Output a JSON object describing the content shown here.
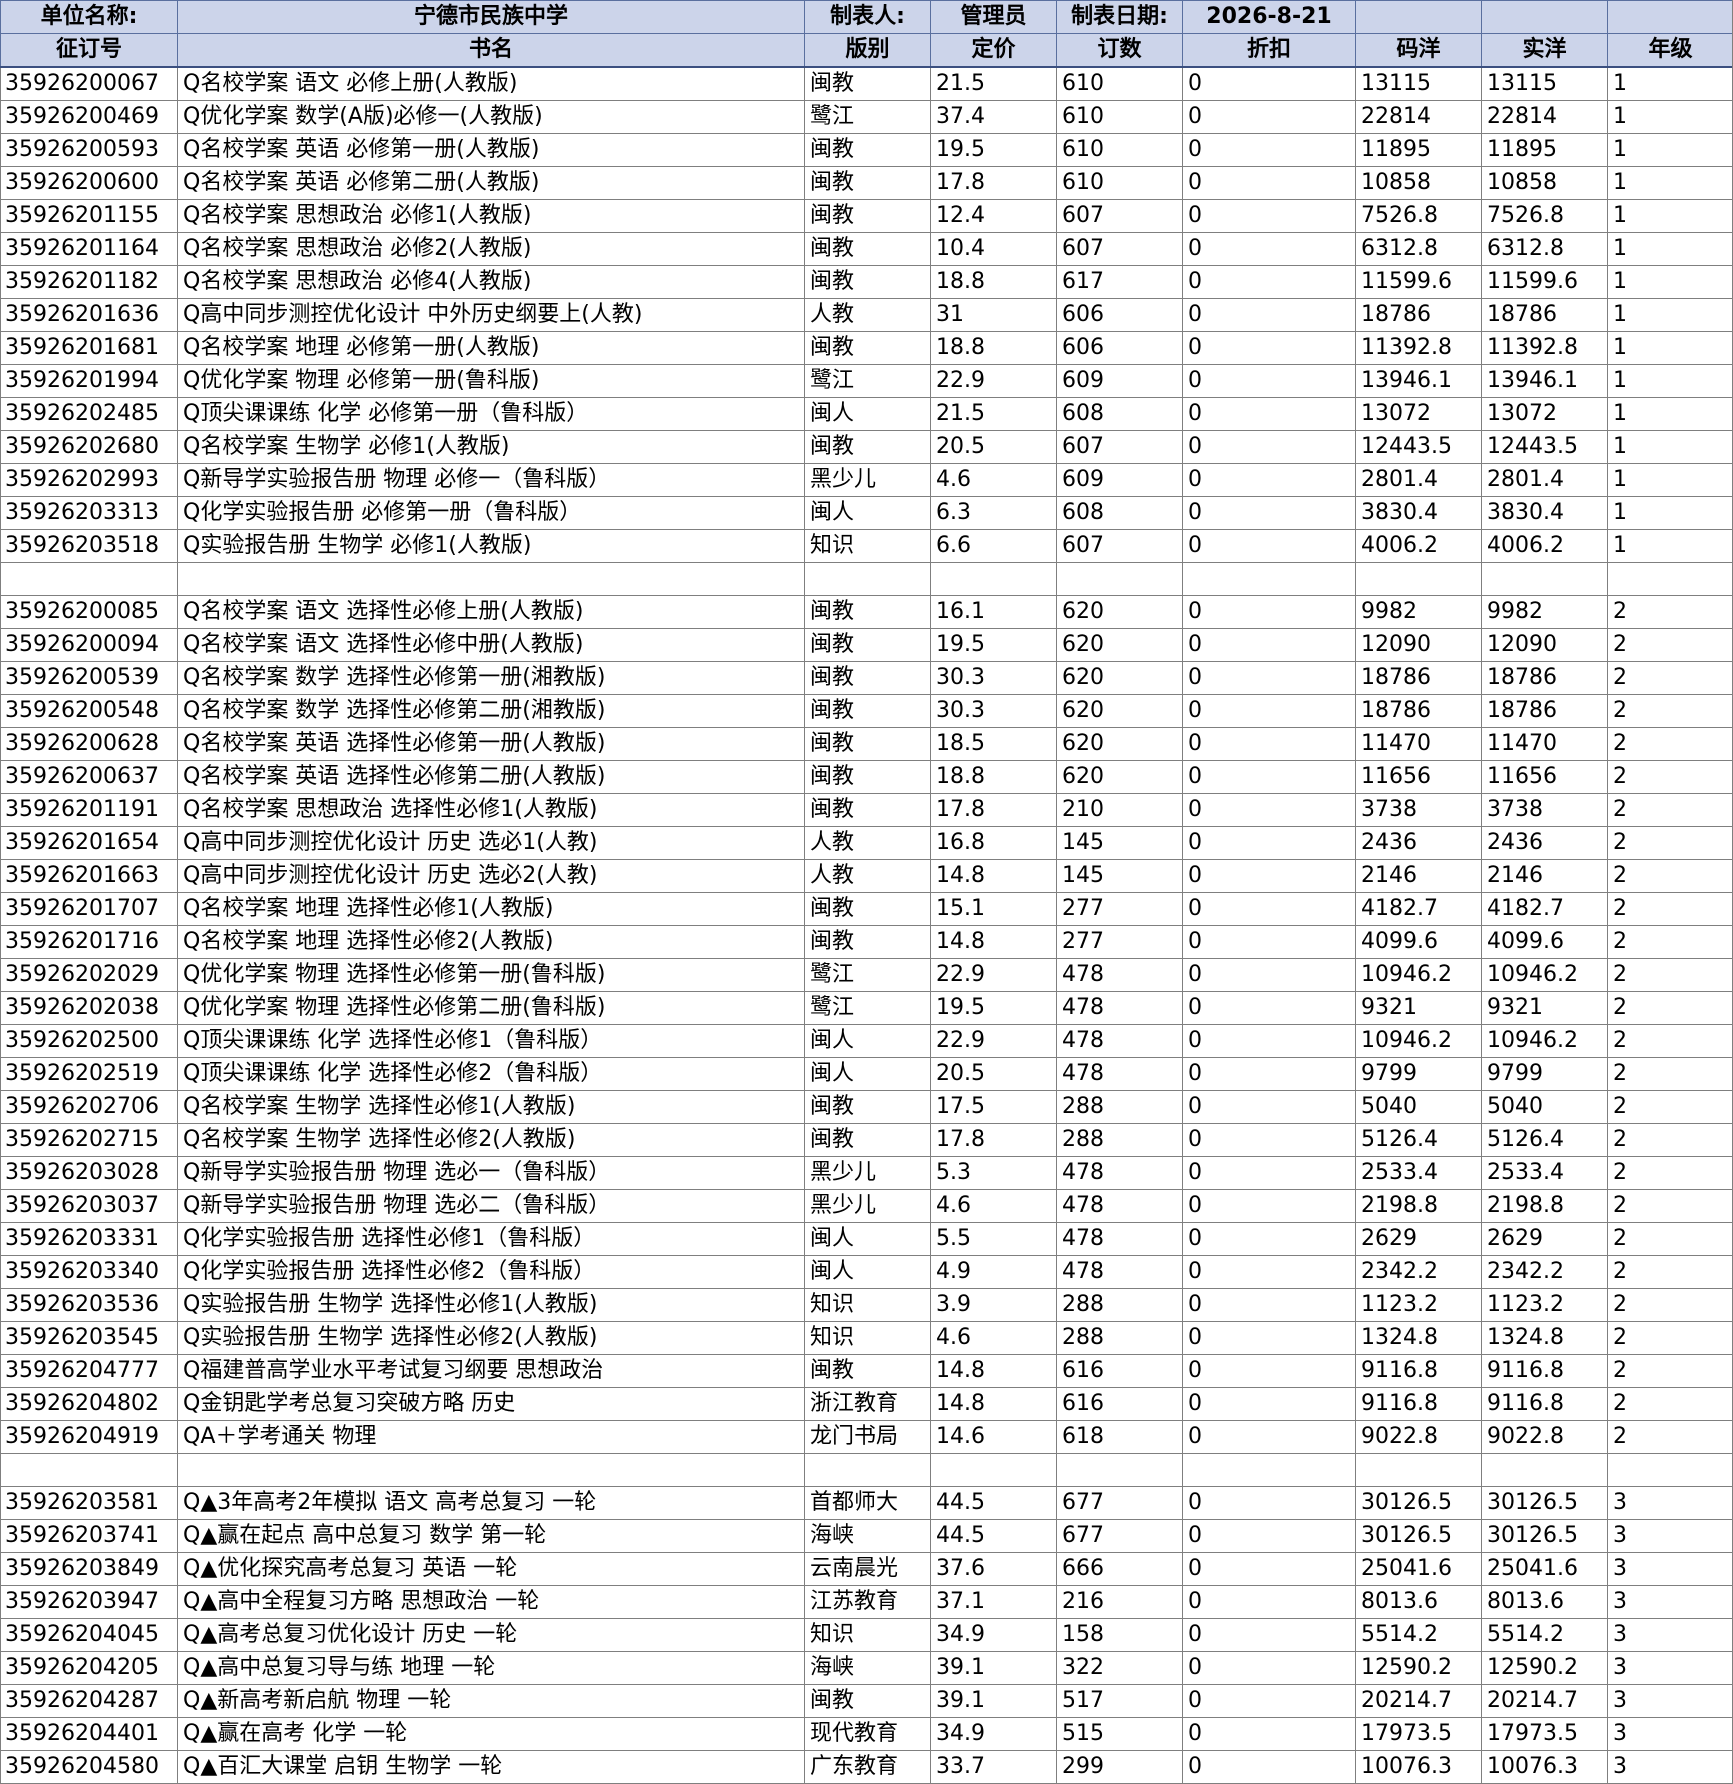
{
  "header": {
    "row0": [
      "单位名称:",
      "宁德市民族中学",
      "制表人:",
      "管理员",
      "制表日期:",
      "2026-8-21",
      "",
      "",
      ""
    ],
    "row1": [
      "征订号",
      "书名",
      "版别",
      "定价",
      "订数",
      "折扣",
      "码洋",
      "实洋",
      "年级"
    ]
  },
  "rows": [
    [
      "35926200067",
      "Q名校学案 语文 必修上册(人教版)",
      "闽教",
      "21.5",
      "610",
      "0",
      "13115",
      "13115",
      "1"
    ],
    [
      "35926200469",
      "Q优化学案 数学(A版)必修一(人教版)",
      "鹭江",
      "37.4",
      "610",
      "0",
      "22814",
      "22814",
      "1"
    ],
    [
      "35926200593",
      "Q名校学案 英语 必修第一册(人教版)",
      "闽教",
      "19.5",
      "610",
      "0",
      "11895",
      "11895",
      "1"
    ],
    [
      "35926200600",
      "Q名校学案 英语 必修第二册(人教版)",
      "闽教",
      "17.8",
      "610",
      "0",
      "10858",
      "10858",
      "1"
    ],
    [
      "35926201155",
      "Q名校学案 思想政治 必修1(人教版)",
      "闽教",
      "12.4",
      "607",
      "0",
      "7526.8",
      "7526.8",
      "1"
    ],
    [
      "35926201164",
      "Q名校学案 思想政治 必修2(人教版)",
      "闽教",
      "10.4",
      "607",
      "0",
      "6312.8",
      "6312.8",
      "1"
    ],
    [
      "35926201182",
      "Q名校学案 思想政治 必修4(人教版)",
      "闽教",
      "18.8",
      "617",
      "0",
      "11599.6",
      "11599.6",
      "1"
    ],
    [
      "35926201636",
      "Q高中同步测控优化设计 中外历史纲要上(人教)",
      "人教",
      "31",
      "606",
      "0",
      "18786",
      "18786",
      "1"
    ],
    [
      "35926201681",
      "Q名校学案 地理 必修第一册(人教版)",
      "闽教",
      "18.8",
      "606",
      "0",
      "11392.8",
      "11392.8",
      "1"
    ],
    [
      "35926201994",
      "Q优化学案 物理 必修第一册(鲁科版)",
      "鹭江",
      "22.9",
      "609",
      "0",
      "13946.1",
      "13946.1",
      "1"
    ],
    [
      "35926202485",
      "Q顶尖课课练 化学 必修第一册（鲁科版）",
      "闽人",
      "21.5",
      "608",
      "0",
      "13072",
      "13072",
      "1"
    ],
    [
      "35926202680",
      "Q名校学案 生物学 必修1(人教版)",
      "闽教",
      "20.5",
      "607",
      "0",
      "12443.5",
      "12443.5",
      "1"
    ],
    [
      "35926202993",
      "Q新导学实验报告册 物理 必修一（鲁科版）",
      "黑少儿",
      "4.6",
      "609",
      "0",
      "2801.4",
      "2801.4",
      "1"
    ],
    [
      "35926203313",
      "Q化学实验报告册 必修第一册（鲁科版）",
      "闽人",
      "6.3",
      "608",
      "0",
      "3830.4",
      "3830.4",
      "1"
    ],
    [
      "35926203518",
      "Q实验报告册 生物学 必修1(人教版)",
      "知识",
      "6.6",
      "607",
      "0",
      "4006.2",
      "4006.2",
      "1"
    ],
    [
      "",
      "",
      "",
      "",
      "",
      "",
      "",
      "",
      ""
    ],
    [
      "35926200085",
      "Q名校学案 语文 选择性必修上册(人教版)",
      "闽教",
      "16.1",
      "620",
      "0",
      "9982",
      "9982",
      "2"
    ],
    [
      "35926200094",
      "Q名校学案 语文 选择性必修中册(人教版)",
      "闽教",
      "19.5",
      "620",
      "0",
      "12090",
      "12090",
      "2"
    ],
    [
      "35926200539",
      "Q名校学案 数学 选择性必修第一册(湘教版)",
      "闽教",
      "30.3",
      "620",
      "0",
      "18786",
      "18786",
      "2"
    ],
    [
      "35926200548",
      "Q名校学案 数学 选择性必修第二册(湘教版)",
      "闽教",
      "30.3",
      "620",
      "0",
      "18786",
      "18786",
      "2"
    ],
    [
      "35926200628",
      "Q名校学案 英语 选择性必修第一册(人教版)",
      "闽教",
      "18.5",
      "620",
      "0",
      "11470",
      "11470",
      "2"
    ],
    [
      "35926200637",
      "Q名校学案 英语 选择性必修第二册(人教版)",
      "闽教",
      "18.8",
      "620",
      "0",
      "11656",
      "11656",
      "2"
    ],
    [
      "35926201191",
      "Q名校学案 思想政治 选择性必修1(人教版)",
      "闽教",
      "17.8",
      "210",
      "0",
      "3738",
      "3738",
      "2"
    ],
    [
      "35926201654",
      "Q高中同步测控优化设计 历史 选必1(人教)",
      "人教",
      "16.8",
      "145",
      "0",
      "2436",
      "2436",
      "2"
    ],
    [
      "35926201663",
      "Q高中同步测控优化设计 历史 选必2(人教)",
      "人教",
      "14.8",
      "145",
      "0",
      "2146",
      "2146",
      "2"
    ],
    [
      "35926201707",
      "Q名校学案 地理 选择性必修1(人教版)",
      "闽教",
      "15.1",
      "277",
      "0",
      "4182.7",
      "4182.7",
      "2"
    ],
    [
      "35926201716",
      "Q名校学案 地理 选择性必修2(人教版)",
      "闽教",
      "14.8",
      "277",
      "0",
      "4099.6",
      "4099.6",
      "2"
    ],
    [
      "35926202029",
      "Q优化学案 物理 选择性必修第一册(鲁科版)",
      "鹭江",
      "22.9",
      "478",
      "0",
      "10946.2",
      "10946.2",
      "2"
    ],
    [
      "35926202038",
      "Q优化学案 物理 选择性必修第二册(鲁科版)",
      "鹭江",
      "19.5",
      "478",
      "0",
      "9321",
      "9321",
      "2"
    ],
    [
      "35926202500",
      "Q顶尖课课练 化学 选择性必修1（鲁科版）",
      "闽人",
      "22.9",
      "478",
      "0",
      "10946.2",
      "10946.2",
      "2"
    ],
    [
      "35926202519",
      "Q顶尖课课练 化学 选择性必修2（鲁科版）",
      "闽人",
      "20.5",
      "478",
      "0",
      "9799",
      "9799",
      "2"
    ],
    [
      "35926202706",
      "Q名校学案 生物学 选择性必修1(人教版)",
      "闽教",
      "17.5",
      "288",
      "0",
      "5040",
      "5040",
      "2"
    ],
    [
      "35926202715",
      "Q名校学案 生物学 选择性必修2(人教版)",
      "闽教",
      "17.8",
      "288",
      "0",
      "5126.4",
      "5126.4",
      "2"
    ],
    [
      "35926203028",
      "Q新导学实验报告册 物理 选必一（鲁科版）",
      "黑少儿",
      "5.3",
      "478",
      "0",
      "2533.4",
      "2533.4",
      "2"
    ],
    [
      "35926203037",
      "Q新导学实验报告册 物理 选必二（鲁科版）",
      "黑少儿",
      "4.6",
      "478",
      "0",
      "2198.8",
      "2198.8",
      "2"
    ],
    [
      "35926203331",
      "Q化学实验报告册 选择性必修1（鲁科版）",
      "闽人",
      "5.5",
      "478",
      "0",
      "2629",
      "2629",
      "2"
    ],
    [
      "35926203340",
      "Q化学实验报告册 选择性必修2（鲁科版）",
      "闽人",
      "4.9",
      "478",
      "0",
      "2342.2",
      "2342.2",
      "2"
    ],
    [
      "35926203536",
      "Q实验报告册 生物学 选择性必修1(人教版)",
      "知识",
      "3.9",
      "288",
      "0",
      "1123.2",
      "1123.2",
      "2"
    ],
    [
      "35926203545",
      "Q实验报告册 生物学 选择性必修2(人教版)",
      "知识",
      "4.6",
      "288",
      "0",
      "1324.8",
      "1324.8",
      "2"
    ],
    [
      "35926204777",
      "Q福建普高学业水平考试复习纲要 思想政治",
      "闽教",
      "14.8",
      "616",
      "0",
      "9116.8",
      "9116.8",
      "2"
    ],
    [
      "35926204802",
      "Q金钥匙学考总复习突破方略 历史",
      "浙江教育",
      "14.8",
      "616",
      "0",
      "9116.8",
      "9116.8",
      "2"
    ],
    [
      "35926204919",
      "QA＋学考通关 物理",
      "龙门书局",
      "14.6",
      "618",
      "0",
      "9022.8",
      "9022.8",
      "2"
    ],
    [
      "",
      "",
      "",
      "",
      "",
      "",
      "",
      "",
      ""
    ],
    [
      "35926203581",
      "Q▲3年高考2年模拟 语文 高考总复习 一轮",
      "首都师大",
      "44.5",
      "677",
      "0",
      "30126.5",
      "30126.5",
      "3"
    ],
    [
      "35926203741",
      "Q▲赢在起点 高中总复习 数学 第一轮",
      "海峡",
      "44.5",
      "677",
      "0",
      "30126.5",
      "30126.5",
      "3"
    ],
    [
      "35926203849",
      "Q▲优化探究高考总复习 英语 一轮",
      "云南晨光",
      "37.6",
      "666",
      "0",
      "25041.6",
      "25041.6",
      "3"
    ],
    [
      "35926203947",
      "Q▲高中全程复习方略 思想政治 一轮",
      "江苏教育",
      "37.1",
      "216",
      "0",
      "8013.6",
      "8013.6",
      "3"
    ],
    [
      "35926204045",
      "Q▲高考总复习优化设计 历史 一轮",
      "知识",
      "34.9",
      "158",
      "0",
      "5514.2",
      "5514.2",
      "3"
    ],
    [
      "35926204205",
      "Q▲高中总复习导与练 地理 一轮",
      "海峡",
      "39.1",
      "322",
      "0",
      "12590.2",
      "12590.2",
      "3"
    ],
    [
      "35926204287",
      "Q▲新高考新启航 物理 一轮",
      "闽教",
      "39.1",
      "517",
      "0",
      "20214.7",
      "20214.7",
      "3"
    ],
    [
      "35926204401",
      "Q▲赢在高考 化学 一轮",
      "现代教育",
      "34.9",
      "515",
      "0",
      "17973.5",
      "17973.5",
      "3"
    ],
    [
      "35926204580",
      "Q▲百汇大课堂 启钥 生物学 一轮",
      "广东教育",
      "33.7",
      "299",
      "0",
      "10076.3",
      "10076.3",
      "3"
    ]
  ]
}
